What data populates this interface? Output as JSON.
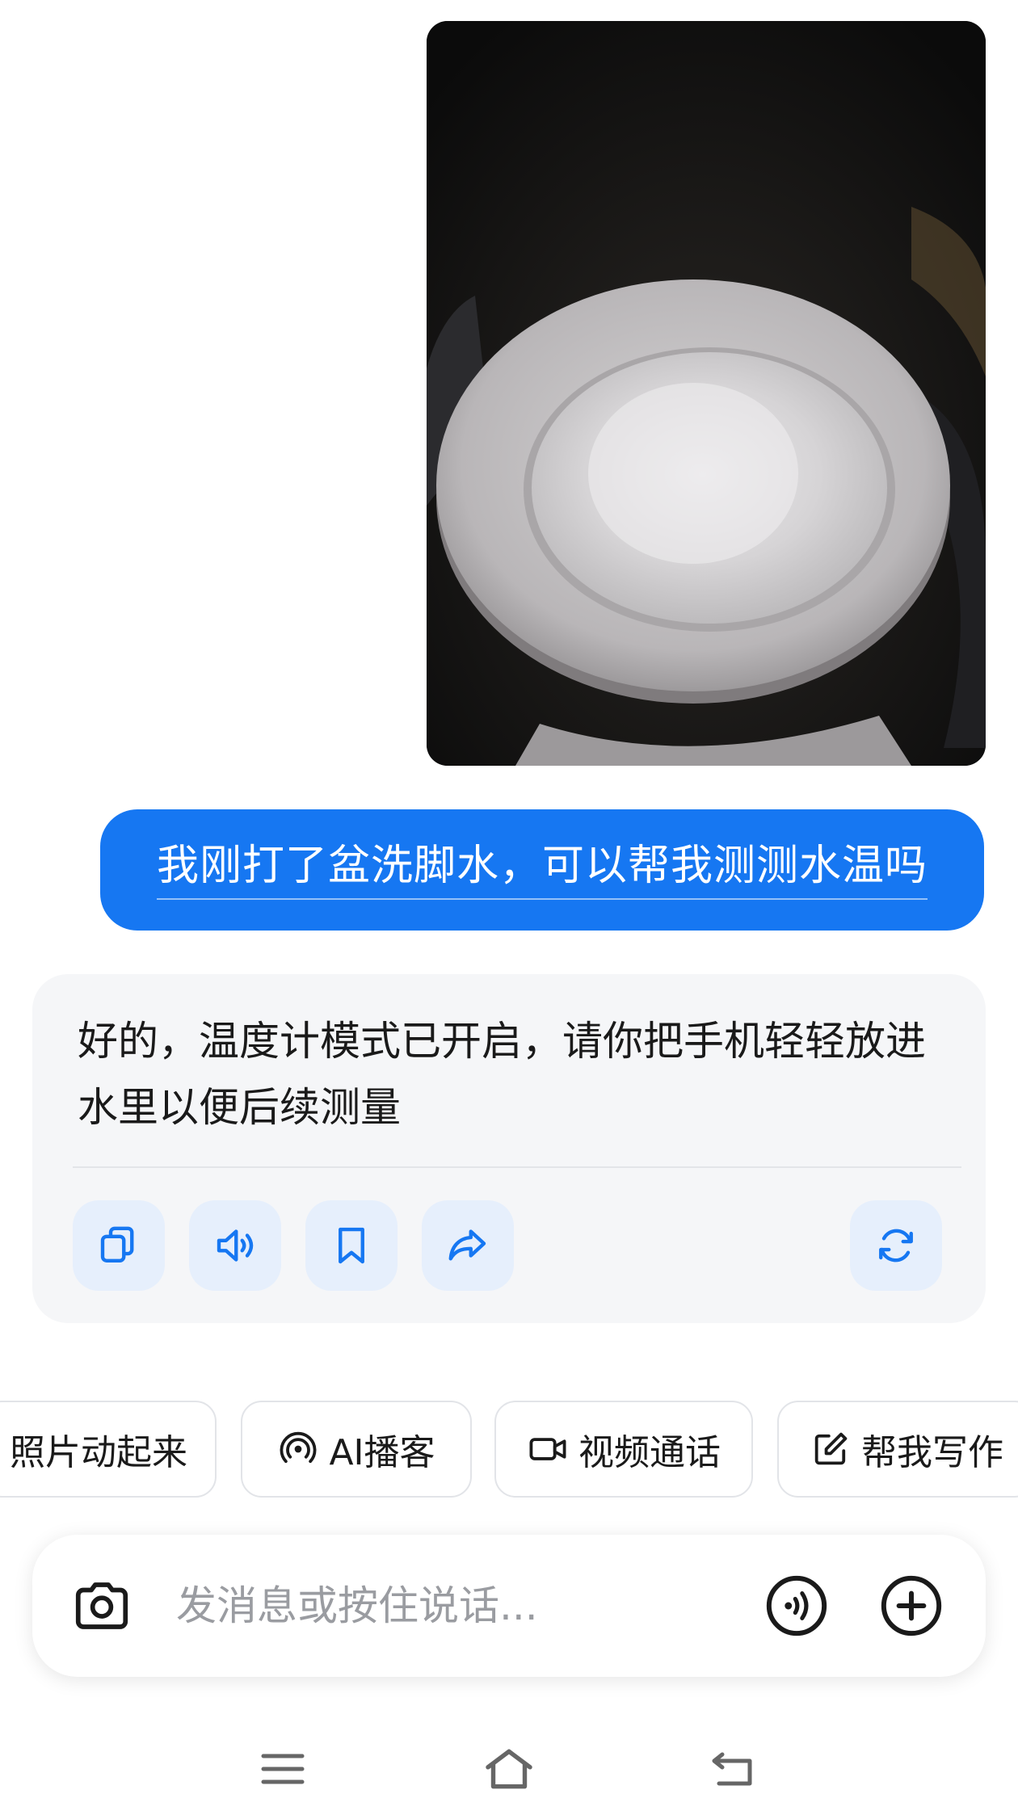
{
  "user_message": {
    "text": "我刚打了盆洗脚水，可以帮我测测水温吗",
    "bubble_color": "#1677f2"
  },
  "assistant_message": {
    "text": "好的，温度计模式已开启，请你把手机轻轻放进水里以便后续测量",
    "actions": [
      {
        "icon": "copy-icon"
      },
      {
        "icon": "speaker-icon"
      },
      {
        "icon": "bookmark-icon"
      },
      {
        "icon": "share-icon"
      },
      {
        "icon": "regenerate-icon"
      }
    ],
    "accent_color": "#1677f2"
  },
  "suggestions": [
    {
      "label": "照片动起来",
      "icon": ""
    },
    {
      "label": "AI播客",
      "icon": "podcast-icon"
    },
    {
      "label": "视频通话",
      "icon": "video-camera-icon"
    },
    {
      "label": "帮我写作",
      "icon": "edit-icon"
    }
  ],
  "input": {
    "placeholder": "发消息或按住说话...",
    "left_icon": "camera-icon",
    "right_icons": [
      "voice-icon",
      "add-icon"
    ]
  },
  "system_nav": [
    "menu-icon",
    "home-icon",
    "back-icon"
  ]
}
